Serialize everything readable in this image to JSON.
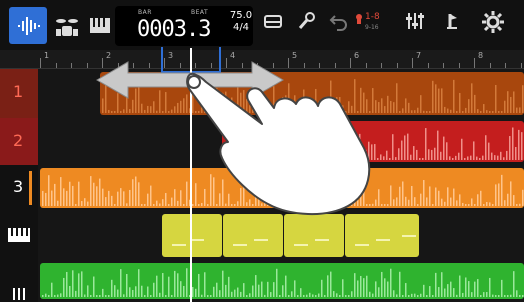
{
  "toolbar": {
    "counter_label_bar": "BAR",
    "counter_label_beat": "BEAT",
    "counter_value": "0003.3",
    "tempo": "75.0",
    "time_signature": "4/4",
    "track_range_top": "1-8",
    "track_range_bottom": "9-16"
  },
  "ruler": {
    "bars": [
      "1",
      "2",
      "3",
      "4",
      "5",
      "6",
      "7",
      "8"
    ]
  },
  "tracks": [
    {
      "number": "1",
      "color": "#e04a3a",
      "region_color": "#c9580f"
    },
    {
      "number": "2",
      "color": "#e04a3a",
      "region_color": "#d82a2a"
    },
    {
      "number": "3",
      "color": "#e88320",
      "region_color": "#ee8a22"
    },
    {
      "number": "",
      "icon": "piano-icon",
      "color": "#d6d64a",
      "region_color": "#d6d640"
    },
    {
      "number": "",
      "icon": "mixer-icon",
      "color": "#2a9a2a",
      "region_color": "#2fb32f"
    }
  ],
  "colors": {
    "accent_blue": "#2f6fd6",
    "playhead": "#ffffff"
  }
}
